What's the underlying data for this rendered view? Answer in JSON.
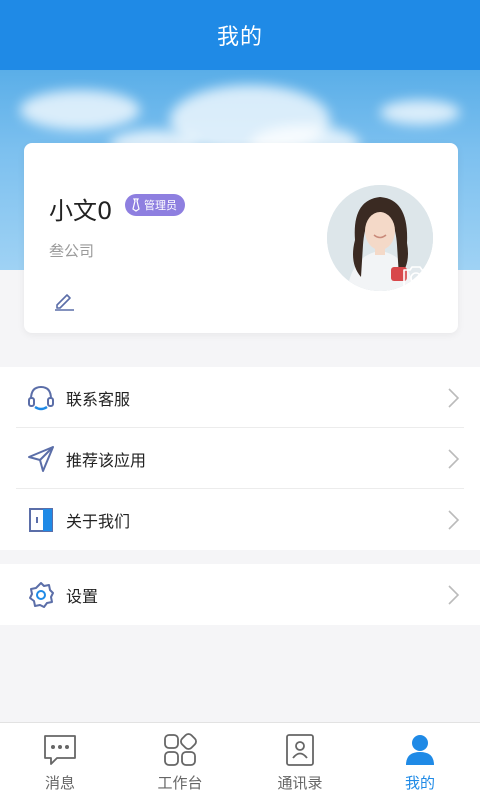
{
  "header": {
    "title": "我的"
  },
  "profile": {
    "name": "小文0",
    "role_badge": "管理员",
    "company": "叁公司"
  },
  "menu_groups": [
    {
      "items": [
        {
          "label": "联系客服",
          "icon": "headset-icon"
        },
        {
          "label": "推荐该应用",
          "icon": "send-arrow-icon"
        },
        {
          "label": "关于我们",
          "icon": "info-door-icon"
        }
      ]
    },
    {
      "items": [
        {
          "label": "设置",
          "icon": "gear-icon"
        }
      ]
    }
  ],
  "tabs": [
    {
      "label": "消息",
      "icon": "message-icon",
      "active": false
    },
    {
      "label": "工作台",
      "icon": "workbench-icon",
      "active": false
    },
    {
      "label": "通讯录",
      "icon": "contacts-icon",
      "active": false
    },
    {
      "label": "我的",
      "icon": "person-icon",
      "active": true
    }
  ],
  "colors": {
    "primary": "#1f8ae6",
    "badge": "#8e7fe0",
    "icon_line": "#5b6ea8"
  }
}
